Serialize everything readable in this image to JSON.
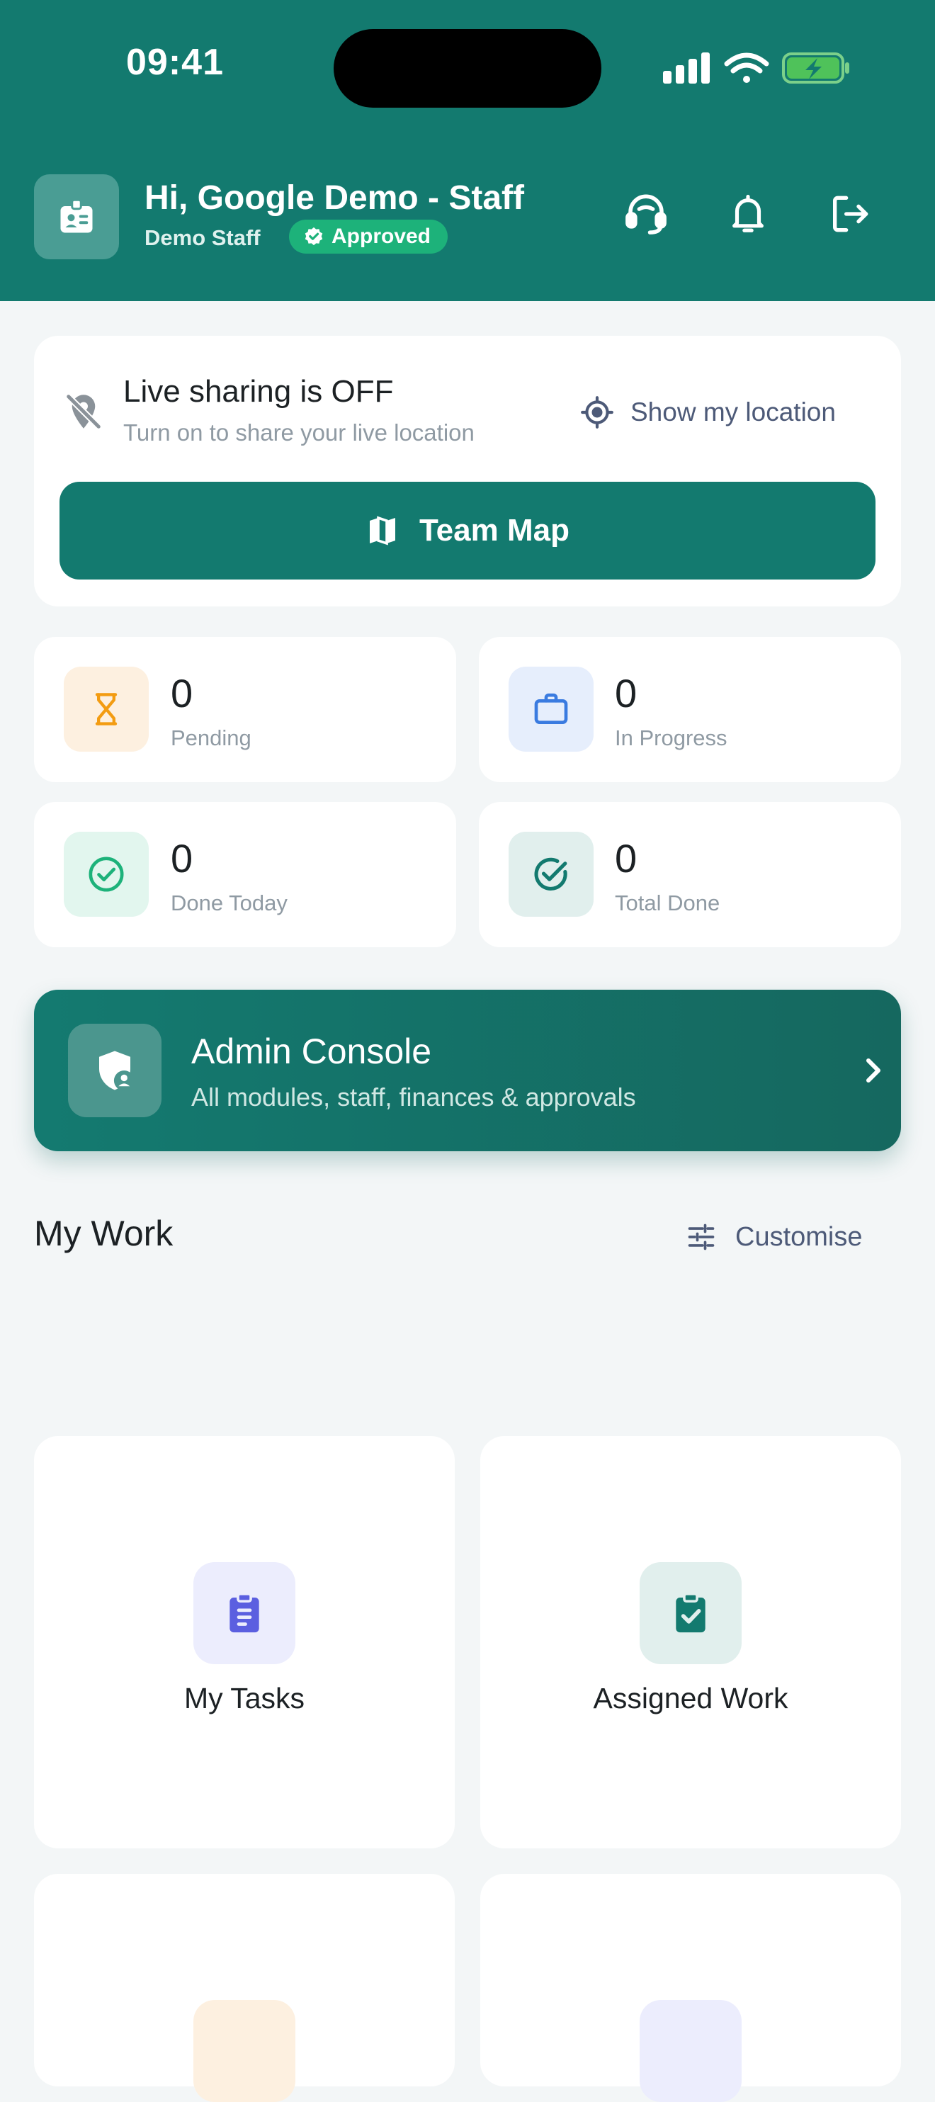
{
  "status_bar": {
    "time": "09:41"
  },
  "header": {
    "greeting": "Hi, Google Demo - Staff",
    "role": "Demo Staff",
    "badge": "Approved",
    "icons": [
      "id-badge-icon",
      "support-headset-icon",
      "bell-icon",
      "logout-icon"
    ]
  },
  "location": {
    "title": "Live sharing is OFF",
    "subtitle": "Turn on to share your live location",
    "show_label": "Show my location",
    "team_map_label": "Team Map"
  },
  "stats": [
    {
      "value": "0",
      "label": "Pending",
      "icon": "hourglass-icon",
      "color": "#f39c12",
      "bg": "#fdf0e0"
    },
    {
      "value": "0",
      "label": "In Progress",
      "icon": "briefcase-icon",
      "color": "#3a7be0",
      "bg": "#e6eefc"
    },
    {
      "value": "0",
      "label": "Done Today",
      "icon": "check-circle-icon",
      "color": "#1db27a",
      "bg": "#e2f6ee"
    },
    {
      "value": "0",
      "label": "Total Done",
      "icon": "check-circle-icon",
      "color": "#137a6f",
      "bg": "#e1efed"
    }
  ],
  "admin": {
    "title": "Admin Console",
    "subtitle": "All modules, staff, finances & approvals"
  },
  "my_work": {
    "title": "My Work",
    "customise_label": "Customise",
    "tiles": [
      {
        "label": "My Tasks",
        "icon": "clipboard-list-icon",
        "color": "#5b5fe0",
        "bg": "#ecedfd"
      },
      {
        "label": "Assigned Work",
        "icon": "clipboard-check-icon",
        "color": "#137a6f",
        "bg": "#e1efed"
      },
      {
        "label": "",
        "icon": "tile-icon",
        "color": "#f39c12",
        "bg": "#fdf0e0"
      },
      {
        "label": "",
        "icon": "tile-icon",
        "color": "#5b5fe0",
        "bg": "#ecedfd"
      }
    ]
  },
  "colors": {
    "primary": "#137a6f",
    "approved": "#1db27a",
    "background": "#f3f6f7"
  }
}
